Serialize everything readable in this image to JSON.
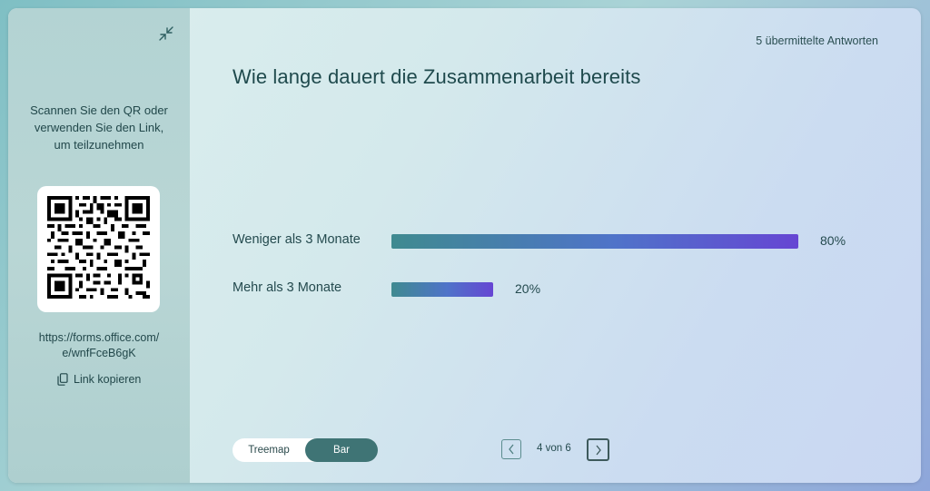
{
  "sidebar": {
    "instructions": "Scannen Sie den QR oder verwenden Sie den Link, um teilzunehmen",
    "link_line1": "https://forms.office.com/",
    "link_line2": "e/wnfFceB6gK",
    "copy_label": "Link kopieren"
  },
  "header": {
    "responses": "5 übermittelte Antworten",
    "question": "Wie lange dauert die Zusammenarbeit bereits"
  },
  "chart_data": {
    "type": "bar",
    "categories": [
      "Weniger als 3 Monate",
      "Mehr als 3 Monate"
    ],
    "values": [
      80,
      20
    ],
    "value_labels": [
      "80%",
      "20%"
    ],
    "ylim": [
      0,
      100
    ]
  },
  "view_toggle": {
    "options": [
      "Treemap",
      "Bar"
    ],
    "selected": "Bar"
  },
  "pager": {
    "label": "4 von 6"
  },
  "colors": {
    "accent": "#3f7475",
    "bar_start": "#3f8a90",
    "bar_end": "#6646d3"
  }
}
